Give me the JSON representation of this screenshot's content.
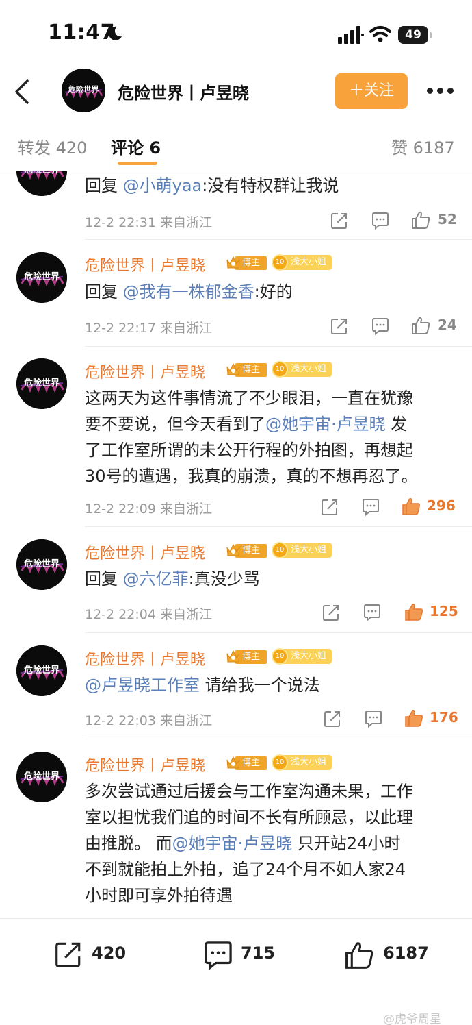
{
  "status_bar": {
    "time": "11:47",
    "battery": "49"
  },
  "header": {
    "title": "危险世界丨卢昱晓",
    "follow_label": "＋关注",
    "avatar_text": "危险世界"
  },
  "tabs": {
    "repost": "转发 420",
    "comments": "评论 6",
    "likes": "赞 6187"
  },
  "badges": {
    "bozhu": "博主",
    "fan_level": "10",
    "fan_title": "浅大小姐"
  },
  "comments": [
    {
      "name": "危险世界丨卢昱晓",
      "prefix": "回复 ",
      "mention": "@小萌yaa",
      "text": ":没有特权群让我说",
      "time": "12-2 22:31 来自浙江",
      "likes": "52",
      "hot": false
    },
    {
      "name": "危险世界丨卢昱晓",
      "prefix": "回复 ",
      "mention": "@我有一株郁金香",
      "text": ":好的",
      "time": "12-2 22:17 来自浙江",
      "likes": "24",
      "hot": false
    },
    {
      "name": "危险世界丨卢昱晓",
      "line1": "这两天为这件事情流了不少眼泪，一直在犹豫",
      "line2_a": "要不要说，但今天看到了",
      "line2_mention": "@她宇宙·卢昱晓",
      "line2_b": " 发",
      "line3": "了工作室所谓的未公开行程的外拍图，再想起",
      "line4": "30号的遭遇，我真的崩溃，真的不想再忍了。",
      "time": "12-2 22:09 来自浙江",
      "likes": "296",
      "hot": true
    },
    {
      "name": "危险世界丨卢昱晓",
      "prefix": "回复 ",
      "mention": "@六亿菲",
      "text": ":真没少骂",
      "time": "12-2 22:04 来自浙江",
      "likes": "125",
      "hot": true
    },
    {
      "name": "危险世界丨卢昱晓",
      "mention": "@卢昱晓工作室",
      "text": " 请给我一个说法",
      "time": "12-2 22:03 来自浙江",
      "likes": "176",
      "hot": true
    },
    {
      "name": "危险世界丨卢昱晓",
      "line1": "多次尝试通过后援会与工作室沟通未果，工作",
      "line2": "室以担忧我们追的时间不长有所顾忌，以此理",
      "line3_a": "由推脱。 而",
      "line3_mention": "@她宇宙·卢昱晓",
      "line3_b": " 只开站24小时",
      "line4": "不到就能拍上外拍，追了24个月不如人家24",
      "line5": "小时即可享外拍待遇"
    }
  ],
  "bottom_bar": {
    "reposts": "420",
    "comments": "715",
    "likes": "6187"
  },
  "watermark": "@虎爷周星",
  "colors": {
    "accent": "#f7a23a",
    "name": "#e8772e",
    "mention": "#5a7fb8"
  }
}
